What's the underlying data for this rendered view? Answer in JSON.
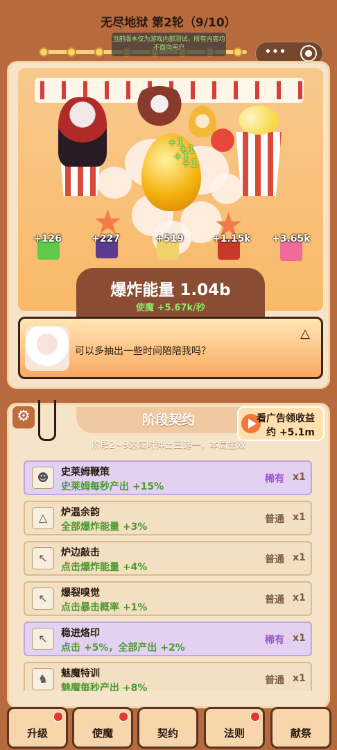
{
  "header": {
    "title": "无尽地狱 第2轮（9/10）",
    "notice": "当前版本仅为游戏内部测试，所有内容均不面向用户"
  },
  "progress": {
    "total_nodes": 10,
    "current_node": 9
  },
  "stage": {
    "gains": [
      "+126",
      "+227",
      "+519",
      "+1.15k",
      "+3.65k"
    ],
    "combo_text": "+1"
  },
  "energy": {
    "label": "爆炸能量 1.04b",
    "rate": "使魔 +5.67k/秒"
  },
  "dialog": {
    "text": "可以多抽出一些时间陪陪我吗？"
  },
  "contract": {
    "title": "阶段契约",
    "subtitle": "阶段2~9达成时弹出三选一，本局生效",
    "ad_line1": "看广告领收益",
    "ad_line2": "约 +5.1m",
    "items": [
      {
        "name": "史莱姆鞭策",
        "desc": "史莱姆每秒产出 +15%",
        "rarity": "稀有",
        "count": "x1",
        "kind": "rare",
        "icon": "slime-icon"
      },
      {
        "name": "炉温余韵",
        "desc": "全部爆炸能量 +3%",
        "rarity": "普通",
        "count": "x1",
        "kind": "common",
        "icon": "warning-icon"
      },
      {
        "name": "炉边敲击",
        "desc": "点击爆炸能量 +4%",
        "rarity": "普通",
        "count": "x1",
        "kind": "common",
        "icon": "cursor-icon"
      },
      {
        "name": "爆裂嗅觉",
        "desc": "点击暴击概率 +1%",
        "rarity": "普通",
        "count": "x1",
        "kind": "common",
        "icon": "cursor-icon"
      },
      {
        "name": "稳进烙印",
        "desc": "点击 +5%，全部产出 +2%",
        "rarity": "稀有",
        "count": "x1",
        "kind": "rare",
        "icon": "cursor-brand-icon"
      },
      {
        "name": "魅魔特训",
        "desc": "魅魔每秒产出 +8%",
        "rarity": "普通",
        "count": "x1",
        "kind": "common",
        "icon": "demon-icon"
      }
    ]
  },
  "nav": [
    {
      "label": "升级",
      "dot": true
    },
    {
      "label": "使魔",
      "dot": true
    },
    {
      "label": "契约",
      "dot": false
    },
    {
      "label": "法则",
      "dot": true
    },
    {
      "label": "献祭",
      "dot": false
    }
  ],
  "colors": {
    "accent": "#c06c3b",
    "rare": "#9a55c8",
    "gain_green": "#4c9a31"
  }
}
